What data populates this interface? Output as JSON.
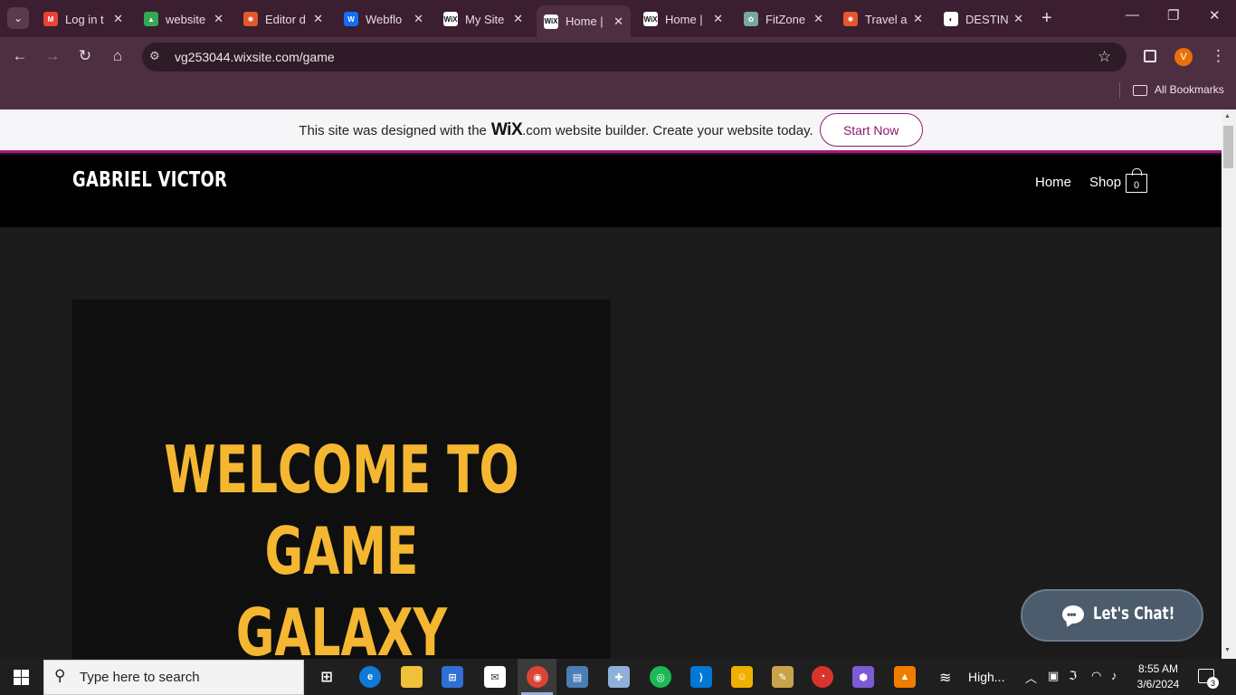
{
  "browser": {
    "tabs": [
      {
        "title": "Log in t",
        "favicon": "gmail-icon",
        "color": "#ea4335",
        "glyph": "M"
      },
      {
        "title": "website",
        "favicon": "drive-icon",
        "color": "#34a853",
        "glyph": "▲"
      },
      {
        "title": "Editor d",
        "favicon": "editor-icon",
        "color": "#e4572e",
        "glyph": "✱"
      },
      {
        "title": "Webflo",
        "favicon": "webflow-icon",
        "color": "#146ef5",
        "glyph": "W"
      },
      {
        "title": "My Site",
        "favicon": "wix-icon",
        "color": "#ffffff",
        "glyph": "WiX"
      },
      {
        "title": "Home |",
        "favicon": "wix-icon",
        "color": "#ffffff",
        "glyph": "WiX"
      },
      {
        "title": "Home |",
        "favicon": "wix-icon",
        "color": "#ffffff",
        "glyph": "WiX"
      },
      {
        "title": "FitZone",
        "favicon": "chatgpt-icon",
        "color": "#74aa9c",
        "glyph": "✿"
      },
      {
        "title": "Travel a",
        "favicon": "editor-icon",
        "color": "#e4572e",
        "glyph": "✱"
      },
      {
        "title": "DESTIN",
        "favicon": "destin-icon",
        "color": "#ffffff",
        "glyph": "◐"
      }
    ],
    "active_tab_index": 5,
    "url": "vg253044.wixsite.com/game",
    "profile_initial": "V",
    "bookmarks_label": "All Bookmarks"
  },
  "wix_banner": {
    "text_before": "This site was designed with the",
    "logo_text": "WiX",
    "text_after": ".com website builder. Create your website today.",
    "cta": "Start Now"
  },
  "site": {
    "brand": "GABRIEL VICTOR",
    "nav": [
      "Home",
      "Shop"
    ],
    "cart_count": "0",
    "hero_lines": [
      "WELCOME TO",
      "GAME",
      "GALAXY"
    ],
    "chat_label": "Let's Chat!"
  },
  "colors": {
    "accent_title": "#f5b731",
    "wix_accent": "#b1157e",
    "chat_bg": "#4c5c6c"
  },
  "taskbar": {
    "search_placeholder": "Type here to search",
    "weather_text": "High...",
    "time": "8:55 AM",
    "date": "3/6/2024",
    "notification_count": "3"
  }
}
